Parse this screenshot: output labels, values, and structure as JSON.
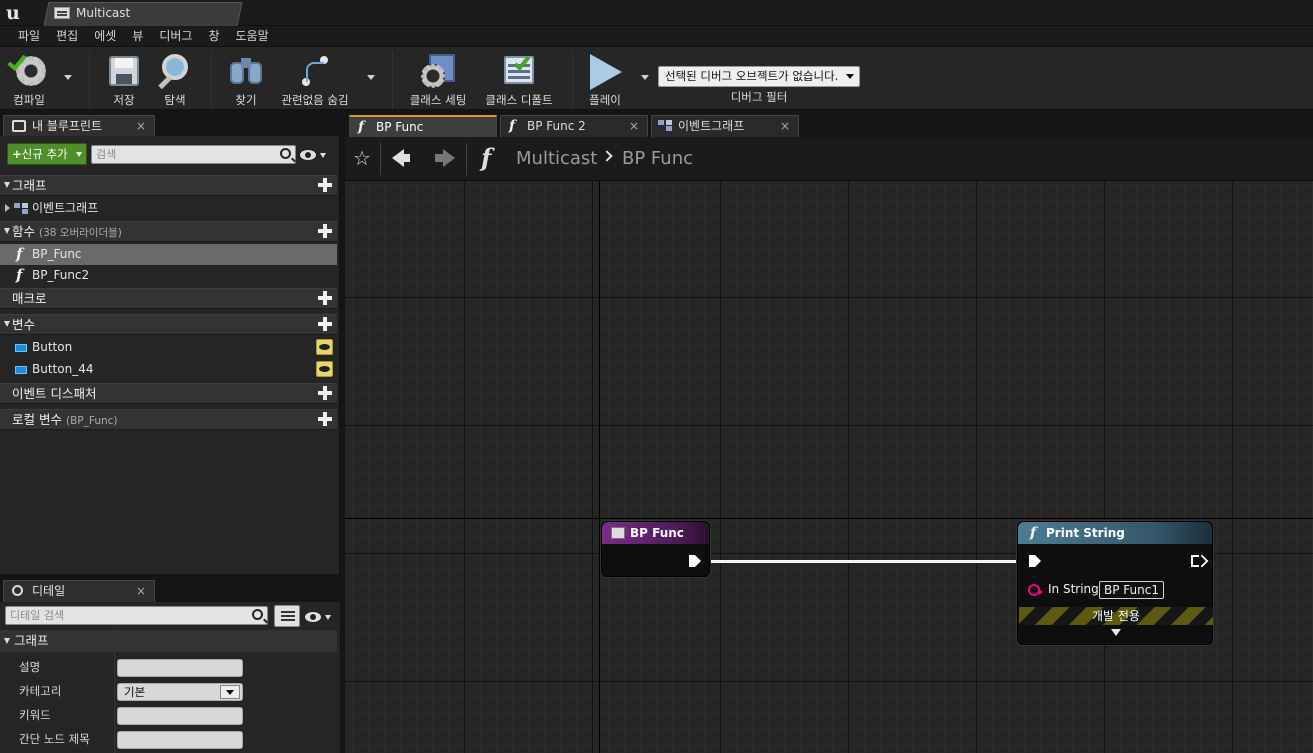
{
  "window": {
    "tab_title": "Multicast"
  },
  "menu": {
    "items": [
      "파일",
      "편집",
      "에셋",
      "뷰",
      "디버그",
      "창",
      "도움말"
    ]
  },
  "toolbar": {
    "compile": "컴파일",
    "save": "저장",
    "browse": "탐색",
    "find": "찾기",
    "hide_unrelated": "관련없음 숨김",
    "class_settings": "클래스 세팅",
    "class_defaults": "클래스 디폴트",
    "play": "플레이",
    "debug_object": "선택된 디버그 오브젝트가 없습니다.",
    "debug_filter": "디버그 필터"
  },
  "my_blueprint": {
    "tab_label": "내 블루프린트",
    "add_new": "신규 추가",
    "search_placeholder": "검색",
    "graphs_label": "그래프",
    "event_graph": "이벤트그래프",
    "functions_label": "함수",
    "functions_overridable": "(38 오버라이더블)",
    "functions": [
      "BP_Func",
      "BP_Func2"
    ],
    "macros_label": "매크로",
    "variables_label": "변수",
    "variables": [
      "Button",
      "Button_44"
    ],
    "dispatchers_label": "이벤트 디스패처",
    "local_vars_label": "로컬 변수",
    "local_vars_scope": "(BP_Func)"
  },
  "details": {
    "tab_label": "디테일",
    "search_placeholder": "디테일 검색",
    "category": "그래프",
    "props": [
      {
        "name": "설명",
        "value": ""
      },
      {
        "name": "카테고리",
        "value": "기본"
      },
      {
        "name": "키워드",
        "value": ""
      },
      {
        "name": "간단 노드 제목",
        "value": ""
      }
    ]
  },
  "editor_tabs": [
    "BP Func",
    "BP Func 2",
    "이벤트그래프"
  ],
  "breadcrumb": {
    "root": "Multicast",
    "current": "BP Func"
  },
  "nodes": {
    "entry": {
      "title": "BP Func",
      "color": "#7a2d8c"
    },
    "print": {
      "title": "Print String",
      "color": "#4d7d92",
      "in_string_label": "In String",
      "in_string_value": "BP Func1",
      "dev_only": "개발 전용"
    }
  },
  "colors": {
    "add_button": "#4f8e2a",
    "string_pin": "#f20090",
    "active_tab": "#d39c2d"
  }
}
